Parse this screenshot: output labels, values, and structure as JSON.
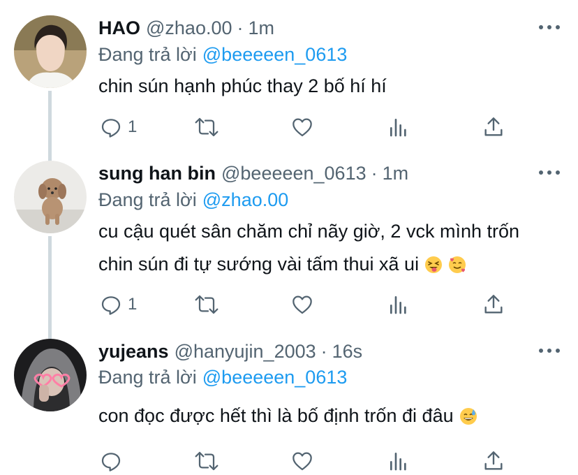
{
  "tweets": [
    {
      "name": "HAO",
      "handle": "@zhao.00",
      "time": "1m",
      "reply_prefix": "Đang trả lời",
      "reply_to": "@beeeeen_0613",
      "text_lines": [
        "chin sún hạnh phúc thay 2 bố hí hí"
      ],
      "reply_count": "1"
    },
    {
      "name": "sung han bin",
      "handle": "@beeeeen_0613",
      "time": "1m",
      "reply_prefix": "Đang trả lời",
      "reply_to": "@zhao.00",
      "text_lines": [
        "cu cậu quét sân chăm chỉ nãy giờ, 2 vck mình trốn",
        "chin sún đi tự sướng vài tấm thui xã ui"
      ],
      "reply_count": "1"
    },
    {
      "name": "yujeans",
      "handle": "@hanyujin_2003",
      "time": "16s",
      "reply_prefix": "Đang trả lời",
      "reply_to": "@beeeeen_0613",
      "text_lines": [
        "con đọc được hết thì là bố định trốn đi đâu"
      ],
      "reply_count": ""
    }
  ],
  "icons": {
    "reply": "reply-icon",
    "retweet": "retweet-icon",
    "like": "heart-icon",
    "views": "analytics-icon",
    "share": "share-icon",
    "more": "more-icon"
  },
  "emojis": [
    "squinting-face-with-tongue",
    "smiling-face-with-hearts",
    "grinning-face-with-sweat"
  ],
  "colors": {
    "link": "#1d9bf0",
    "secondary": "#536471",
    "text": "#0f1419",
    "thread_line": "#cfd9de"
  }
}
